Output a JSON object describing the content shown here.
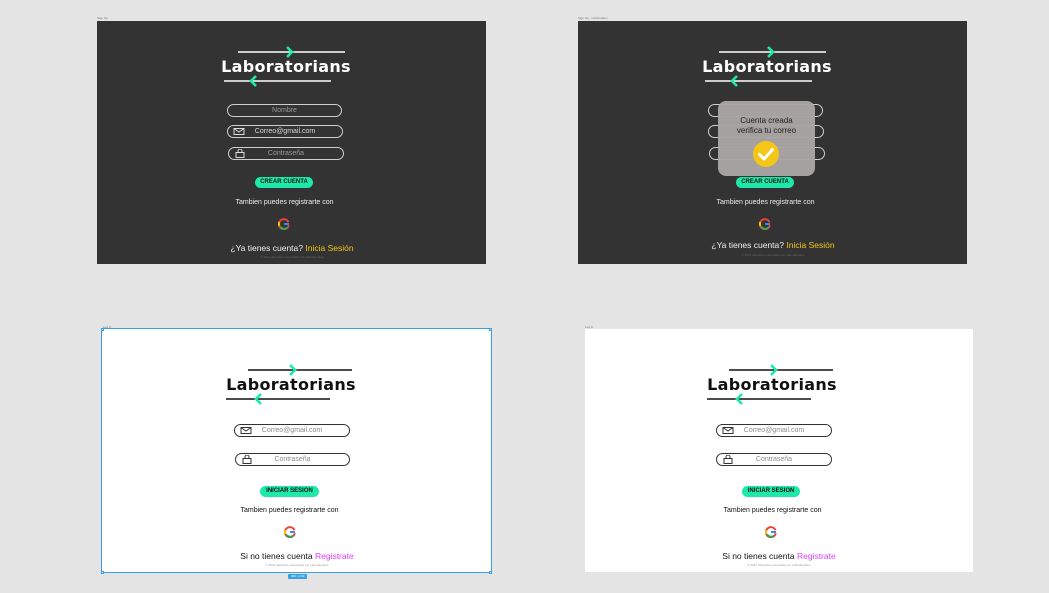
{
  "brand": {
    "name": "Laboratorians"
  },
  "frames": [
    {
      "label": "Sign Up"
    },
    {
      "label": "Sign Up - confirmation"
    },
    {
      "label": "Log In"
    },
    {
      "label": "Log In"
    }
  ],
  "signup": {
    "name_placeholder": "Nombre",
    "email_placeholder": "Correo@gmail.com",
    "password_placeholder": "Contraseña",
    "button_label": "CREAR CUENTA",
    "alt_text": "Tambien puedes registrarte con",
    "bottom_prefix": "¿Ya tienes cuenta?",
    "bottom_link": "Inicia Sesión",
    "copyright": "© 2021 derechos reservados por Laboratorians"
  },
  "modal": {
    "line1": "Cuenta creada",
    "line2": "verifica tu correo",
    "icon": "check-circle-icon"
  },
  "login": {
    "email_placeholder": "Correo@gmail.com",
    "password_placeholder": "Contraseña",
    "button_label": "INICIAR SESION",
    "alt_text": "Tambien puedes registrarte con",
    "bottom_prefix": "Si no tienes cuenta",
    "bottom_link": "Registrate",
    "copyright": "© 2021 derechos reservados por Laboratorians"
  },
  "selection": {
    "size_label": "390 × 243"
  },
  "colors": {
    "accent": "#1de9a8",
    "dark_bg": "#333333",
    "link_yellow": "#f5c518",
    "link_pink": "#e040fb",
    "canvas": "#e4e4e4"
  }
}
